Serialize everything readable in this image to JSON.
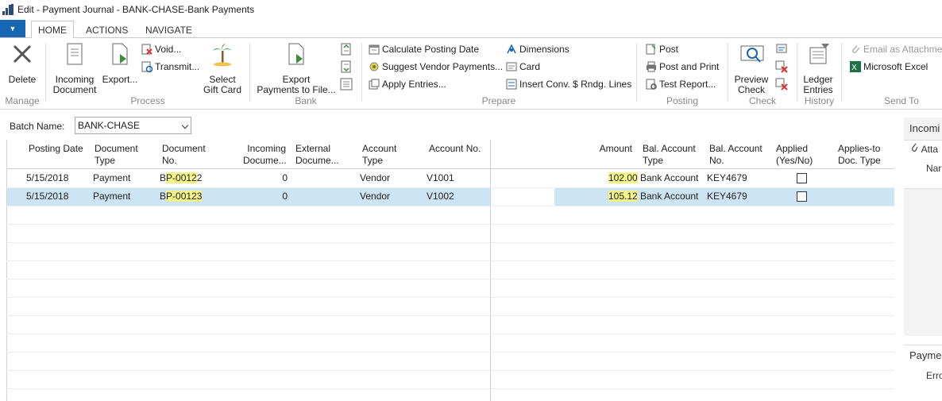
{
  "window": {
    "title": "Edit - Payment Journal - BANK-CHASE-Bank Payments"
  },
  "tabs": [
    {
      "label": "HOME"
    },
    {
      "label": "ACTIONS"
    },
    {
      "label": "NAVIGATE"
    }
  ],
  "ribbon": {
    "manage": {
      "label": "Manage",
      "delete": "Delete"
    },
    "process": {
      "label": "Process",
      "incoming_document": "Incoming\nDocument",
      "incoming_document_l1": "Incoming",
      "incoming_document_l2": "Document",
      "export": "Export...",
      "void": "Void...",
      "transmit": "Transmit...",
      "select_gift_card_l1": "Select",
      "select_gift_card_l2": "Gift Card"
    },
    "bank": {
      "label": "Bank",
      "export_payments_l1": "Export",
      "export_payments_l2": "Payments to File..."
    },
    "prepare": {
      "label": "Prepare",
      "calculate_posting_date": "Calculate Posting Date",
      "suggest_vendor_payments": "Suggest Vendor Payments...",
      "apply_entries": "Apply Entries...",
      "dimensions": "Dimensions",
      "card": "Card",
      "insert_conv": "Insert Conv. $ Rndg. Lines"
    },
    "posting": {
      "label": "Posting",
      "post": "Post",
      "post_and_print": "Post and Print",
      "test_report": "Test Report..."
    },
    "check": {
      "label": "Check",
      "preview_check_l1": "Preview",
      "preview_check_l2": "Check"
    },
    "history": {
      "label": "History",
      "ledger_entries_l1": "Ledger",
      "ledger_entries_l2": "Entries"
    },
    "send_to": {
      "label": "Send To",
      "email_as_attachment": "Email as Attachme",
      "microsoft_excel": "Microsoft Excel"
    }
  },
  "filter": {
    "batch_label": "Batch Name:",
    "batch_value": "BANK-CHASE"
  },
  "grid": {
    "headers": {
      "posting_date": "Posting Date",
      "document_type_l1": "Document",
      "document_type_l2": "Type",
      "document_no_l1": "Document",
      "document_no_l2": "No.",
      "incoming_doc_l1": "Incoming",
      "incoming_doc_l2": "Docume...",
      "external_doc_l1": "External",
      "external_doc_l2": "Docume...",
      "account_type_l1": "Account",
      "account_type_l2": "Type",
      "account_no": "Account No.",
      "amount": "Amount",
      "bal_account_type_l1": "Bal. Account",
      "bal_account_type_l2": "Type",
      "bal_account_no_l1": "Bal. Account",
      "bal_account_no_l2": "No.",
      "applied_l1": "Applied",
      "applied_l2": "(Yes/No)",
      "applies_to_l1": "Applies-to",
      "applies_to_l2": "Doc. Type"
    },
    "rows": [
      {
        "posting_date": "5/15/2018",
        "document_type": "Payment",
        "doc_prefix": "B",
        "doc_highlight": "P-0012",
        "doc_suffix": "2",
        "incoming_doc": "0",
        "account_type": "Vendor",
        "account_no": "V1001",
        "amount": "102.00",
        "bal_account_type": "Bank Account",
        "bal_account_no": "KEY4679",
        "applied": false
      },
      {
        "posting_date": "5/15/2018",
        "document_type": "Payment",
        "doc_prefix": "B",
        "doc_highlight": "P-00123",
        "doc_suffix": "",
        "incoming_doc": "0",
        "account_type": "Vendor",
        "account_no": "V1002",
        "amount": "105.12",
        "bal_account_type": "Bank Account",
        "bal_account_no": "KEY4679",
        "applied": false
      }
    ]
  },
  "factbox": {
    "incoming_title": "Incomi",
    "attach_label": "Atta",
    "name_label": "Nar",
    "payment_title": "Payme",
    "error_label": "Erro"
  },
  "colors": {
    "accent": "#1567b3",
    "selection": "#cde4f5",
    "highlight": "#f5f58a"
  }
}
